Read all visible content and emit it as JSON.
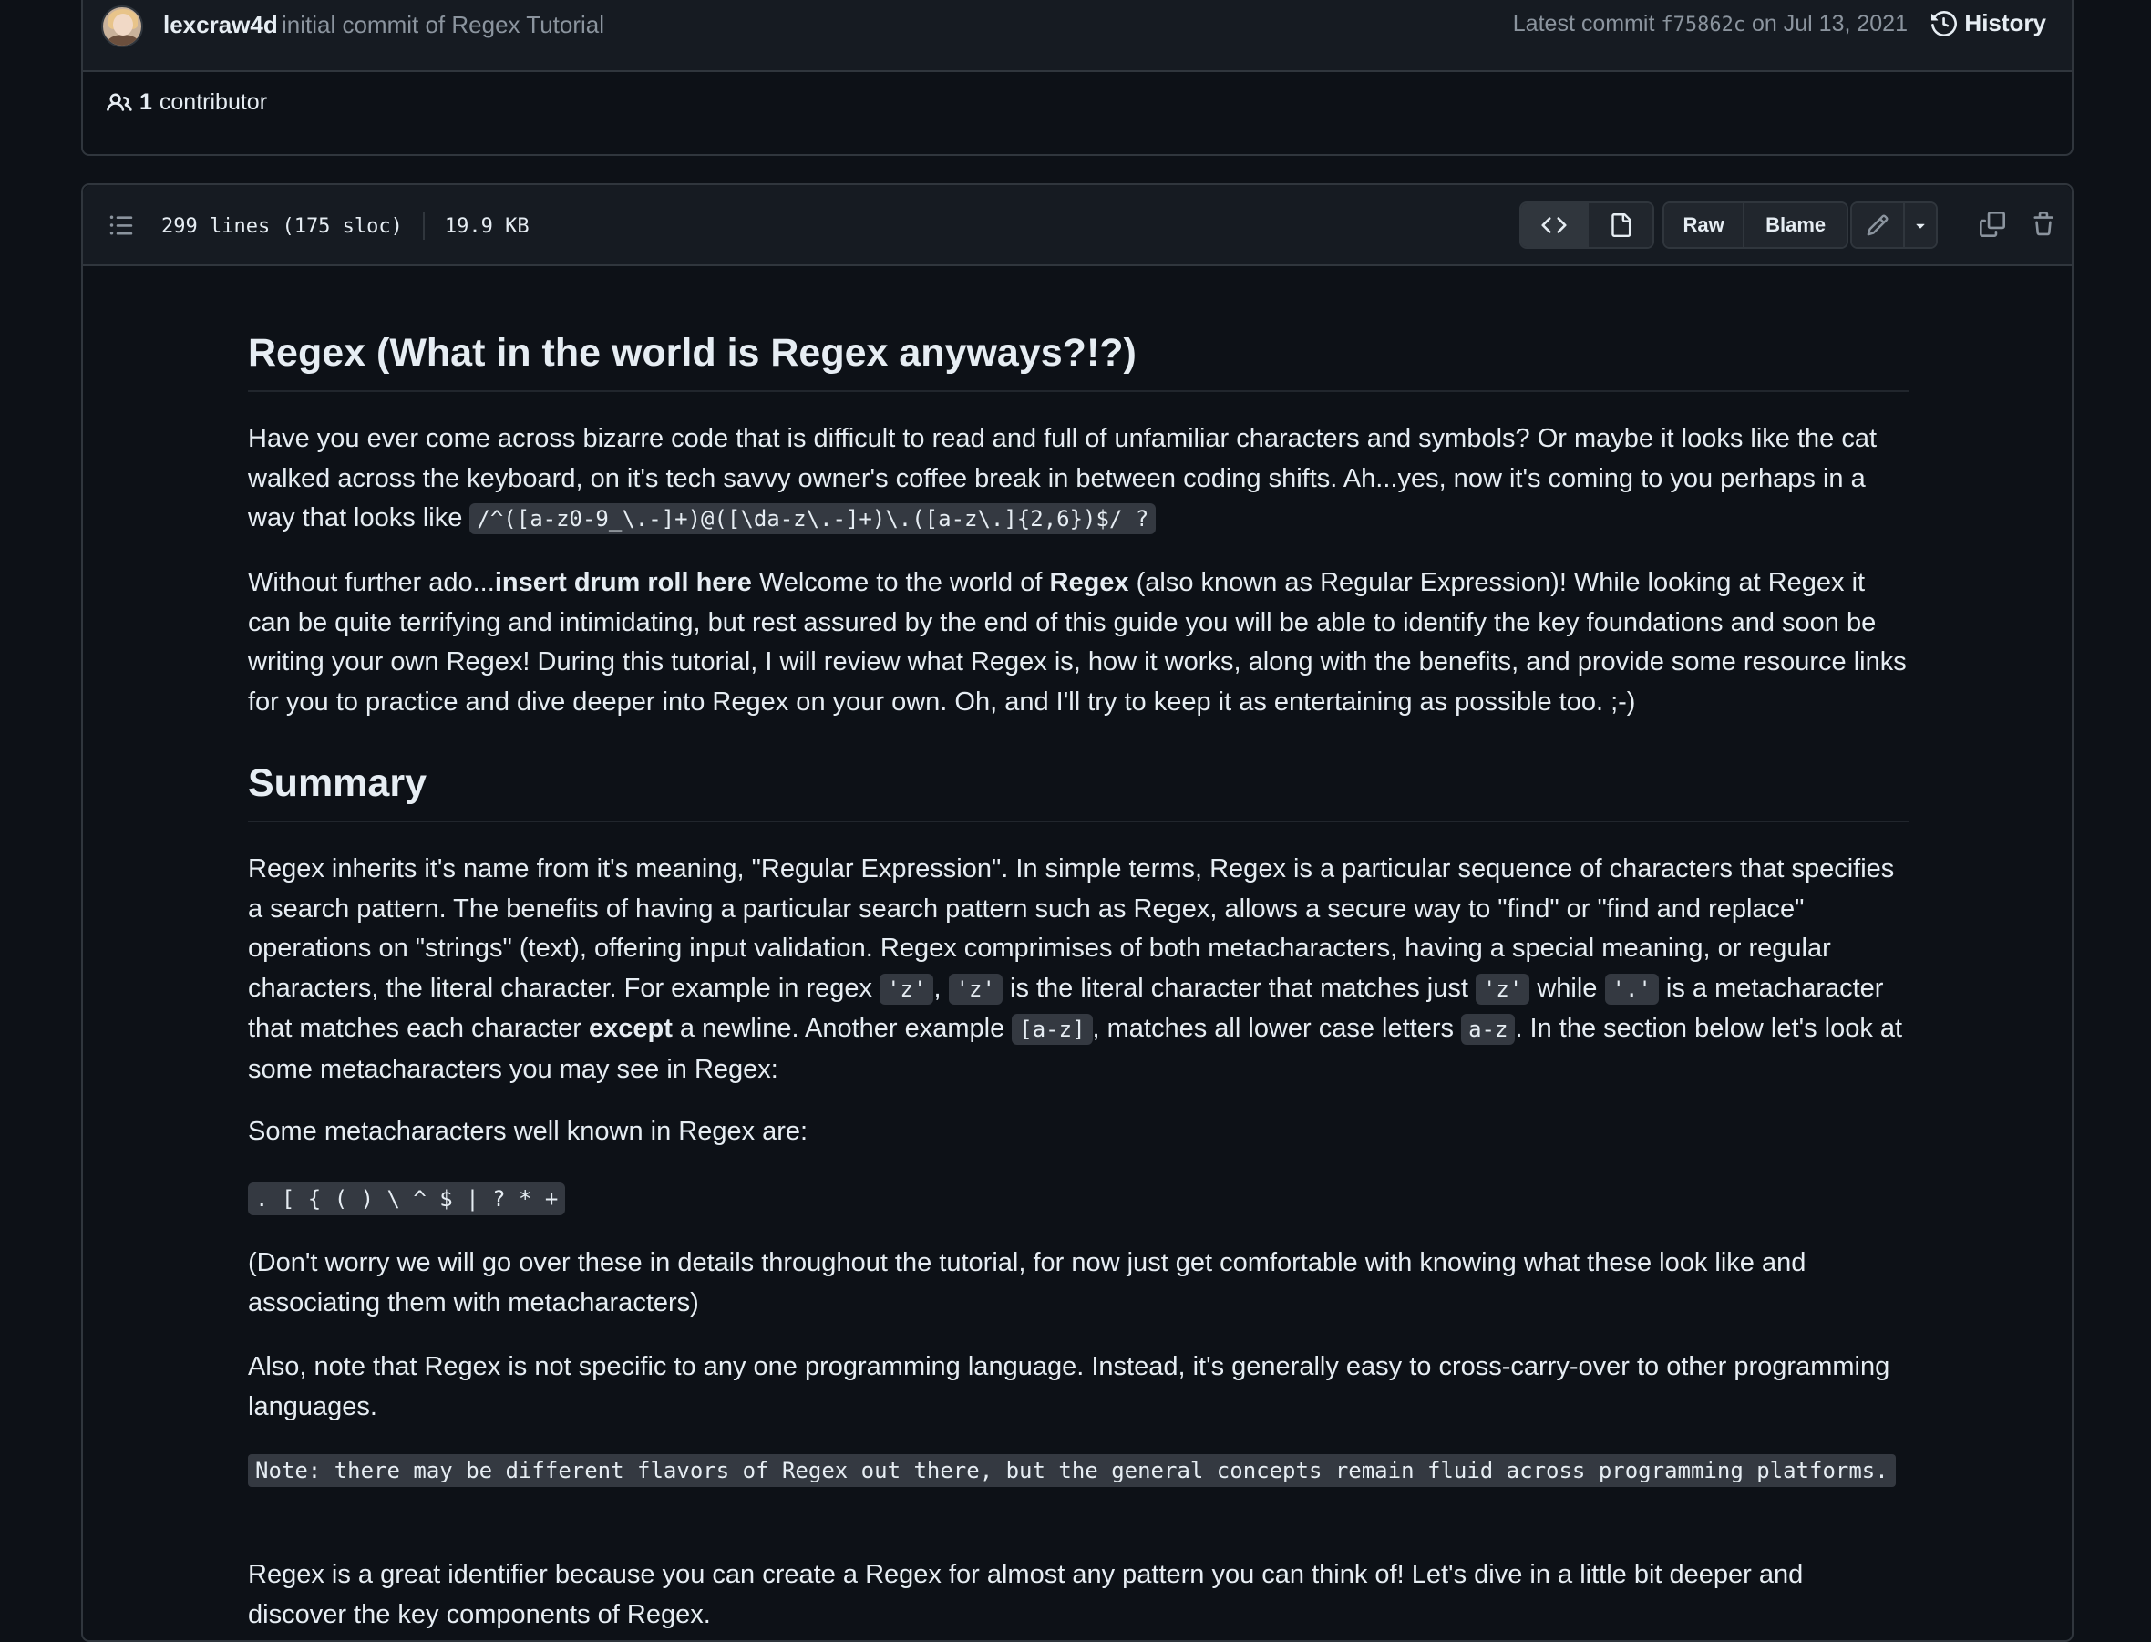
{
  "commit": {
    "author": "lexcraw4d",
    "message": "initial commit of Regex Tutorial",
    "latest_label": "Latest commit",
    "sha": "f75862c",
    "date_text": "on Jul 13, 2021",
    "history_label": "History",
    "contributors_count": "1",
    "contributors_label": "contributor"
  },
  "file": {
    "lines": "299 lines (175 sloc)",
    "size": "19.9 KB",
    "raw_label": "Raw",
    "blame_label": "Blame"
  },
  "content": {
    "h1": "Regex (What in the world is Regex anyways?!?)",
    "p1_text": "Have you ever come across bizarre code that is difficult to read and full of unfamiliar characters and symbols? Or maybe it looks like the cat walked across the keyboard, on it's tech savvy owner's coffee break in between coding shifts. Ah...yes, now it's coming to you perhaps in a way that looks like ",
    "p1_code": "/^([a-z0-9_\\.-]+)@([\\da-z\\.-]+)\\.([a-z\\.]{2,6})$/ ?",
    "p2_a": "Without further ado...",
    "p2_bold1": "insert drum roll here",
    "p2_b": " Welcome to the world of ",
    "p2_bold2": "Regex",
    "p2_c": " (also known as Regular Expression)! While looking at Regex it can be quite terrifying and intimidating, but rest assured by the end of this guide you will be able to identify the key foundations and soon be writing your own Regex! During this tutorial, I will review what Regex is, how it works, along with the benefits, and provide some resource links for you to practice and dive deeper into Regex on your own. Oh, and I'll try to keep it as entertaining as possible too. ;-)",
    "h2": "Summary",
    "p3_a": "Regex inherits it's name from it's meaning, \"Regular Expression\". In simple terms, Regex is a particular sequence of characters that specifies a search pattern. The benefits of having a particular search pattern such as Regex, allows a secure way to \"find\" or \"find and replace\" operations on \"strings\" (text), offering input validation. Regex comprimises of both metacharacters, having a special meaning, or regular characters, the literal character. For example in regex ",
    "p3_code1": "'z'",
    "p3_b": ", ",
    "p3_code2": "'z'",
    "p3_c": " is the literal character that matches just ",
    "p3_code3": "'z'",
    "p3_d": " while ",
    "p3_code4": "'.'",
    "p3_e": " is a metacharacter that matches each character ",
    "p3_bold": "except",
    "p3_f": " a newline. Another example ",
    "p3_code5": "[a-z]",
    "p3_g": ", matches all lower case letters ",
    "p3_code6": "a-z",
    "p3_h": ". In the section below let's look at some metacharacters you may see in Regex:",
    "p4": "Some metacharacters well known in Regex are:",
    "metachars": ". [ { ( ) \\ ^ $ | ? * +",
    "p5": "(Don't worry we will go over these in details throughout the tutorial, for now just get comfortable with knowing what these look like and associating them with metacharacters)",
    "p6": "Also, note that Regex is not specific to any one programming language. Instead, it's generally easy to cross-carry-over to other programming languages.",
    "note": "Note: there may be different flavors of Regex out there, but the general concepts remain fluid across programming platforms.",
    "p7": "Regex is a great identifier because you can create a Regex for almost any pattern you can think of! Let's dive in a little bit deeper and discover the key components of Regex."
  }
}
